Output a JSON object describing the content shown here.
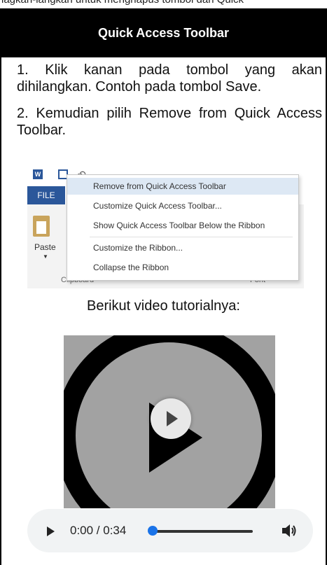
{
  "page": {
    "top_cut_text": "lagkah-langkah untuk menghapus tombol dari Quick",
    "header_title": "Quick Access Toolbar",
    "steps": [
      "1. Klik kanan pada tombol yang akan dihilangkan. Contoh pada tombol Save.",
      "2. Kemudian pilih Remove from Quick Access Toolbar."
    ],
    "video_label": "Berikut video tutorialnya:"
  },
  "screenshot": {
    "word_icon_text": "W",
    "file_tab": "FILE",
    "paste_label": "Paste",
    "group_labels": [
      "Clipboard",
      "Font"
    ],
    "context_menu": [
      {
        "label": "Remove from Quick Access Toolbar",
        "highlighted": true
      },
      {
        "label": "Customize Quick Access Toolbar...",
        "highlighted": false
      },
      {
        "label": "Show Quick Access Toolbar Below the Ribbon",
        "highlighted": false
      },
      {
        "label": "Customize the Ribbon...",
        "highlighted": false
      },
      {
        "label": "Collapse the Ribbon",
        "highlighted": false
      }
    ]
  },
  "video": {
    "current_time": "0:00",
    "duration": "0:34",
    "time_display": "0:00 / 0:34",
    "progress": 0,
    "icons": [
      "play-icon",
      "volume-icon"
    ]
  },
  "colors": {
    "header_bg": "#000000",
    "word_blue": "#2b579a",
    "menu_highlight": "#dde8f4",
    "slider_thumb": "#1a73e8",
    "video_bg": "#a2a2a2"
  }
}
